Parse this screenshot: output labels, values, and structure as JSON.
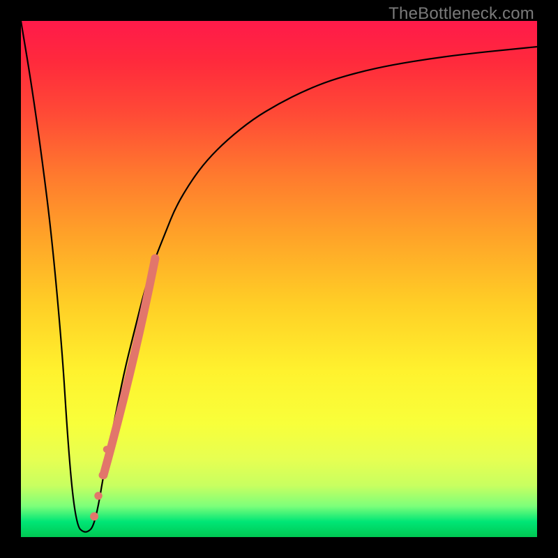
{
  "watermark": "TheBottleneck.com",
  "colors": {
    "curve": "#000000",
    "highlight": "#e2766b",
    "frame": "#000000"
  },
  "chart_data": {
    "type": "line",
    "title": "",
    "xlabel": "",
    "ylabel": "",
    "xlim": [
      0,
      100
    ],
    "ylim": [
      0,
      100
    ],
    "grid": false,
    "legend": false,
    "series": [
      {
        "name": "bottleneck-curve",
        "x": [
          0,
          2,
          4,
          6,
          8,
          9,
          10,
          11,
          12,
          13,
          14,
          15,
          16,
          18,
          20,
          22,
          24,
          26,
          28,
          30,
          33,
          36,
          40,
          45,
          50,
          55,
          60,
          66,
          72,
          80,
          88,
          95,
          100
        ],
        "y": [
          100,
          88,
          74,
          58,
          36,
          20,
          8,
          2,
          1,
          1,
          2,
          6,
          12,
          22,
          32,
          40,
          48,
          54,
          59,
          64,
          69,
          73,
          77,
          81,
          84,
          86.5,
          88.5,
          90.2,
          91.5,
          92.8,
          93.8,
          94.5,
          95
        ]
      }
    ],
    "highlight_segment": {
      "name": "emphasized-band",
      "x": [
        16,
        26
      ],
      "y": [
        12,
        54
      ]
    },
    "dots": [
      {
        "x": 14.2,
        "y": 4
      },
      {
        "x": 15.0,
        "y": 8
      },
      {
        "x": 15.8,
        "y": 12
      },
      {
        "x": 16.6,
        "y": 17
      }
    ]
  }
}
